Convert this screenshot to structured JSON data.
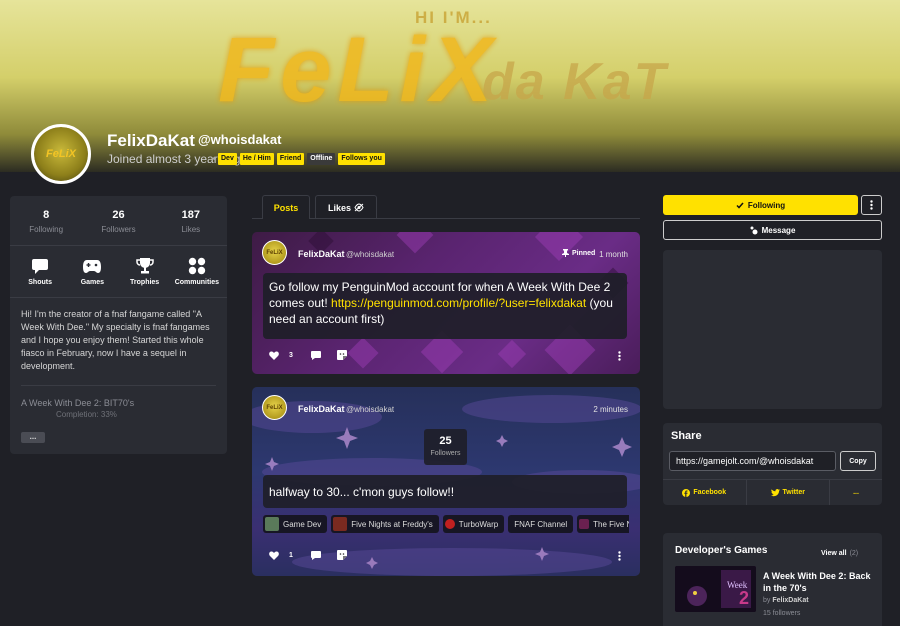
{
  "banner": {
    "hi": "HI I'M...",
    "felix": "FeLiX",
    "dakat": "da KaT"
  },
  "profile": {
    "name": "FelixDaKat",
    "handle": "@whoisdakat",
    "joined": "Joined almost 3 years ago",
    "tags": [
      "Dev",
      "He / Him",
      "Friend",
      "Offline",
      "Follows you"
    ],
    "avatar_text": "FeLiX"
  },
  "stats": [
    {
      "value": "8",
      "label": "Following"
    },
    {
      "value": "26",
      "label": "Followers"
    },
    {
      "value": "187",
      "label": "Likes"
    }
  ],
  "nav": [
    {
      "label": "Shouts",
      "icon": "shouts-icon"
    },
    {
      "label": "Games",
      "icon": "gamepad-icon"
    },
    {
      "label": "Trophies",
      "icon": "trophy-icon"
    },
    {
      "label": "Communities",
      "icon": "communities-icon"
    }
  ],
  "bio": "Hi! I'm the creator of a fnaf fangame called \"A Week With Dee.\" My specialty is fnaf fangames and I hope you enjoy them! Started this whole fiasco in February, now I have a sequel in development.",
  "trophy_game": {
    "title": "A Week With Dee 2: BIT70's",
    "completion": "Completion: 33%",
    "more": "..."
  },
  "tabs": [
    {
      "label": "Posts",
      "active": true
    },
    {
      "label": "Likes",
      "active": false
    }
  ],
  "posts": [
    {
      "author": "FelixDaKat",
      "handle": "@whoisdakat",
      "pinned": "Pinned",
      "time": "1 month",
      "text_before": "Go follow my PenguinMod account for when A Week With Dee 2 comes out! ",
      "link": "https://penguinmod.com/profile/?user=felixdakat",
      "text_after": " (you need an account first)",
      "likes": "3"
    },
    {
      "author": "FelixDaKat",
      "handle": "@whoisdakat",
      "time": "2 minutes",
      "followers_value": "25",
      "followers_label": "Followers",
      "text": "halfway to 30... c'mon guys follow!!",
      "likes": "1",
      "communities": [
        {
          "label": "Game Dev",
          "color": "#5a7a5a"
        },
        {
          "label": "Five Nights at Freddy's",
          "color": "#7a2a20"
        },
        {
          "label": "TurboWarp",
          "color": "#c02020"
        },
        {
          "label": "FNAF Channel",
          "color": "#3a3a3a"
        },
        {
          "label": "The Five Nig",
          "color": "#6a2050"
        }
      ]
    }
  ],
  "actions": {
    "following": "Following",
    "message": "Message"
  },
  "share": {
    "title": "Share",
    "url": "https://gamejolt.com/@whoisdakat",
    "copy": "Copy",
    "facebook": "Facebook",
    "twitter": "Twitter",
    "more": "..."
  },
  "dev_games": {
    "title": "Developer's Games",
    "view_all": "View all",
    "count": "(2)",
    "game_title": "A Week With Dee 2: Back in the 70's",
    "by_prefix": "by",
    "by_name": "FelixDaKat",
    "followers": "15 followers"
  },
  "colors": {
    "accent": "#ffe100",
    "background": "#1f2026",
    "panel": "#2a2c33"
  }
}
